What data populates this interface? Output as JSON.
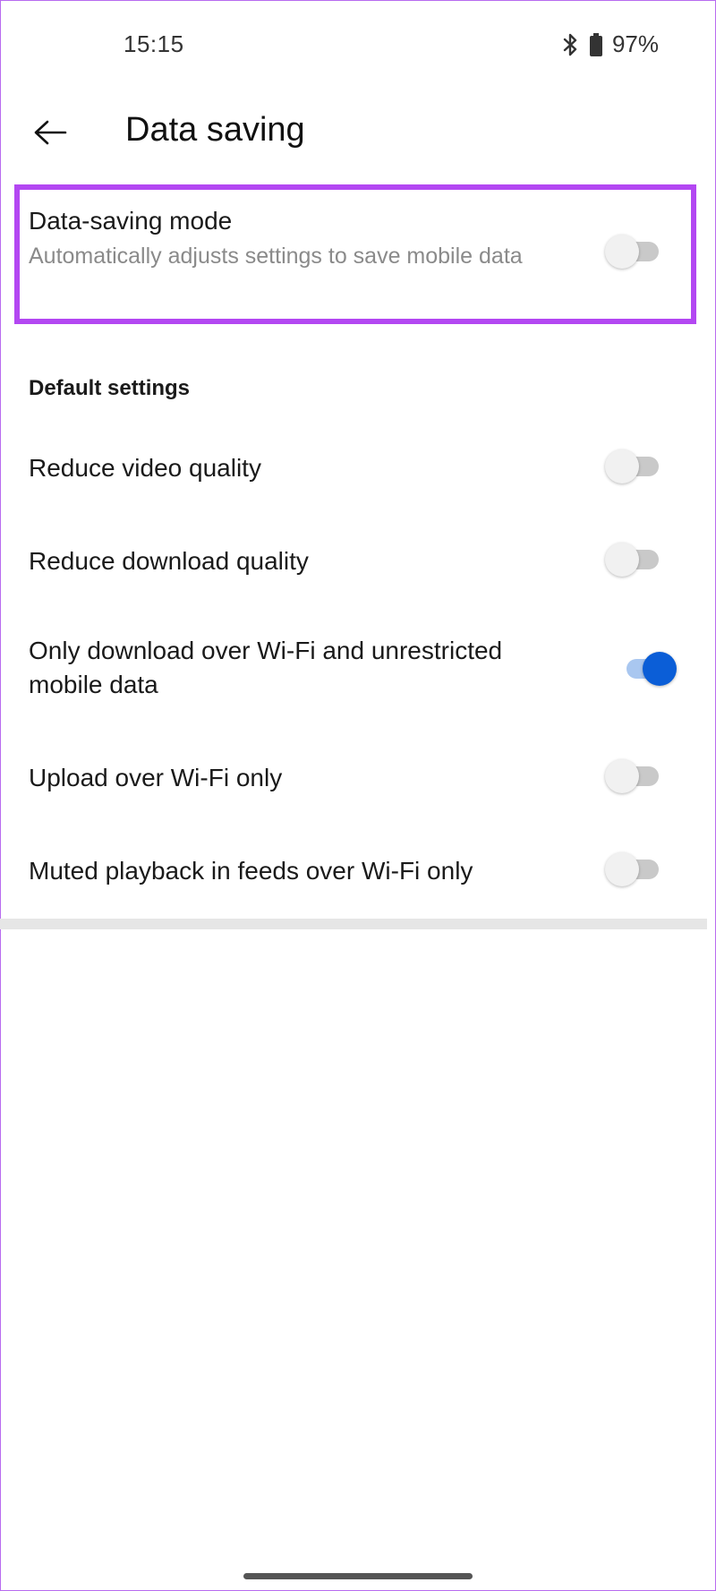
{
  "status_bar": {
    "time": "15:15",
    "battery_text": "97%",
    "icons": [
      "bluetooth-icon",
      "battery-icon"
    ]
  },
  "header": {
    "back_icon": "arrow-left-icon",
    "title": "Data saving"
  },
  "data_saving_mode": {
    "title": "Data-saving mode",
    "subtitle": "Automatically adjusts settings to save mobile data",
    "enabled": false
  },
  "default_settings": {
    "header": "Default settings",
    "items": [
      {
        "label": "Reduce video quality",
        "enabled": false
      },
      {
        "label": "Reduce download quality",
        "enabled": false
      },
      {
        "label": "Only download over Wi-Fi and unrestricted mobile data",
        "enabled": true
      },
      {
        "label": "Upload over Wi-Fi only",
        "enabled": false
      },
      {
        "label": "Muted playback in feeds over Wi-Fi only",
        "enabled": false
      }
    ]
  },
  "colors": {
    "highlight": "#b347f2",
    "toggle_on": "#0b5ed7",
    "toggle_off_track": "#c9c9c9"
  }
}
